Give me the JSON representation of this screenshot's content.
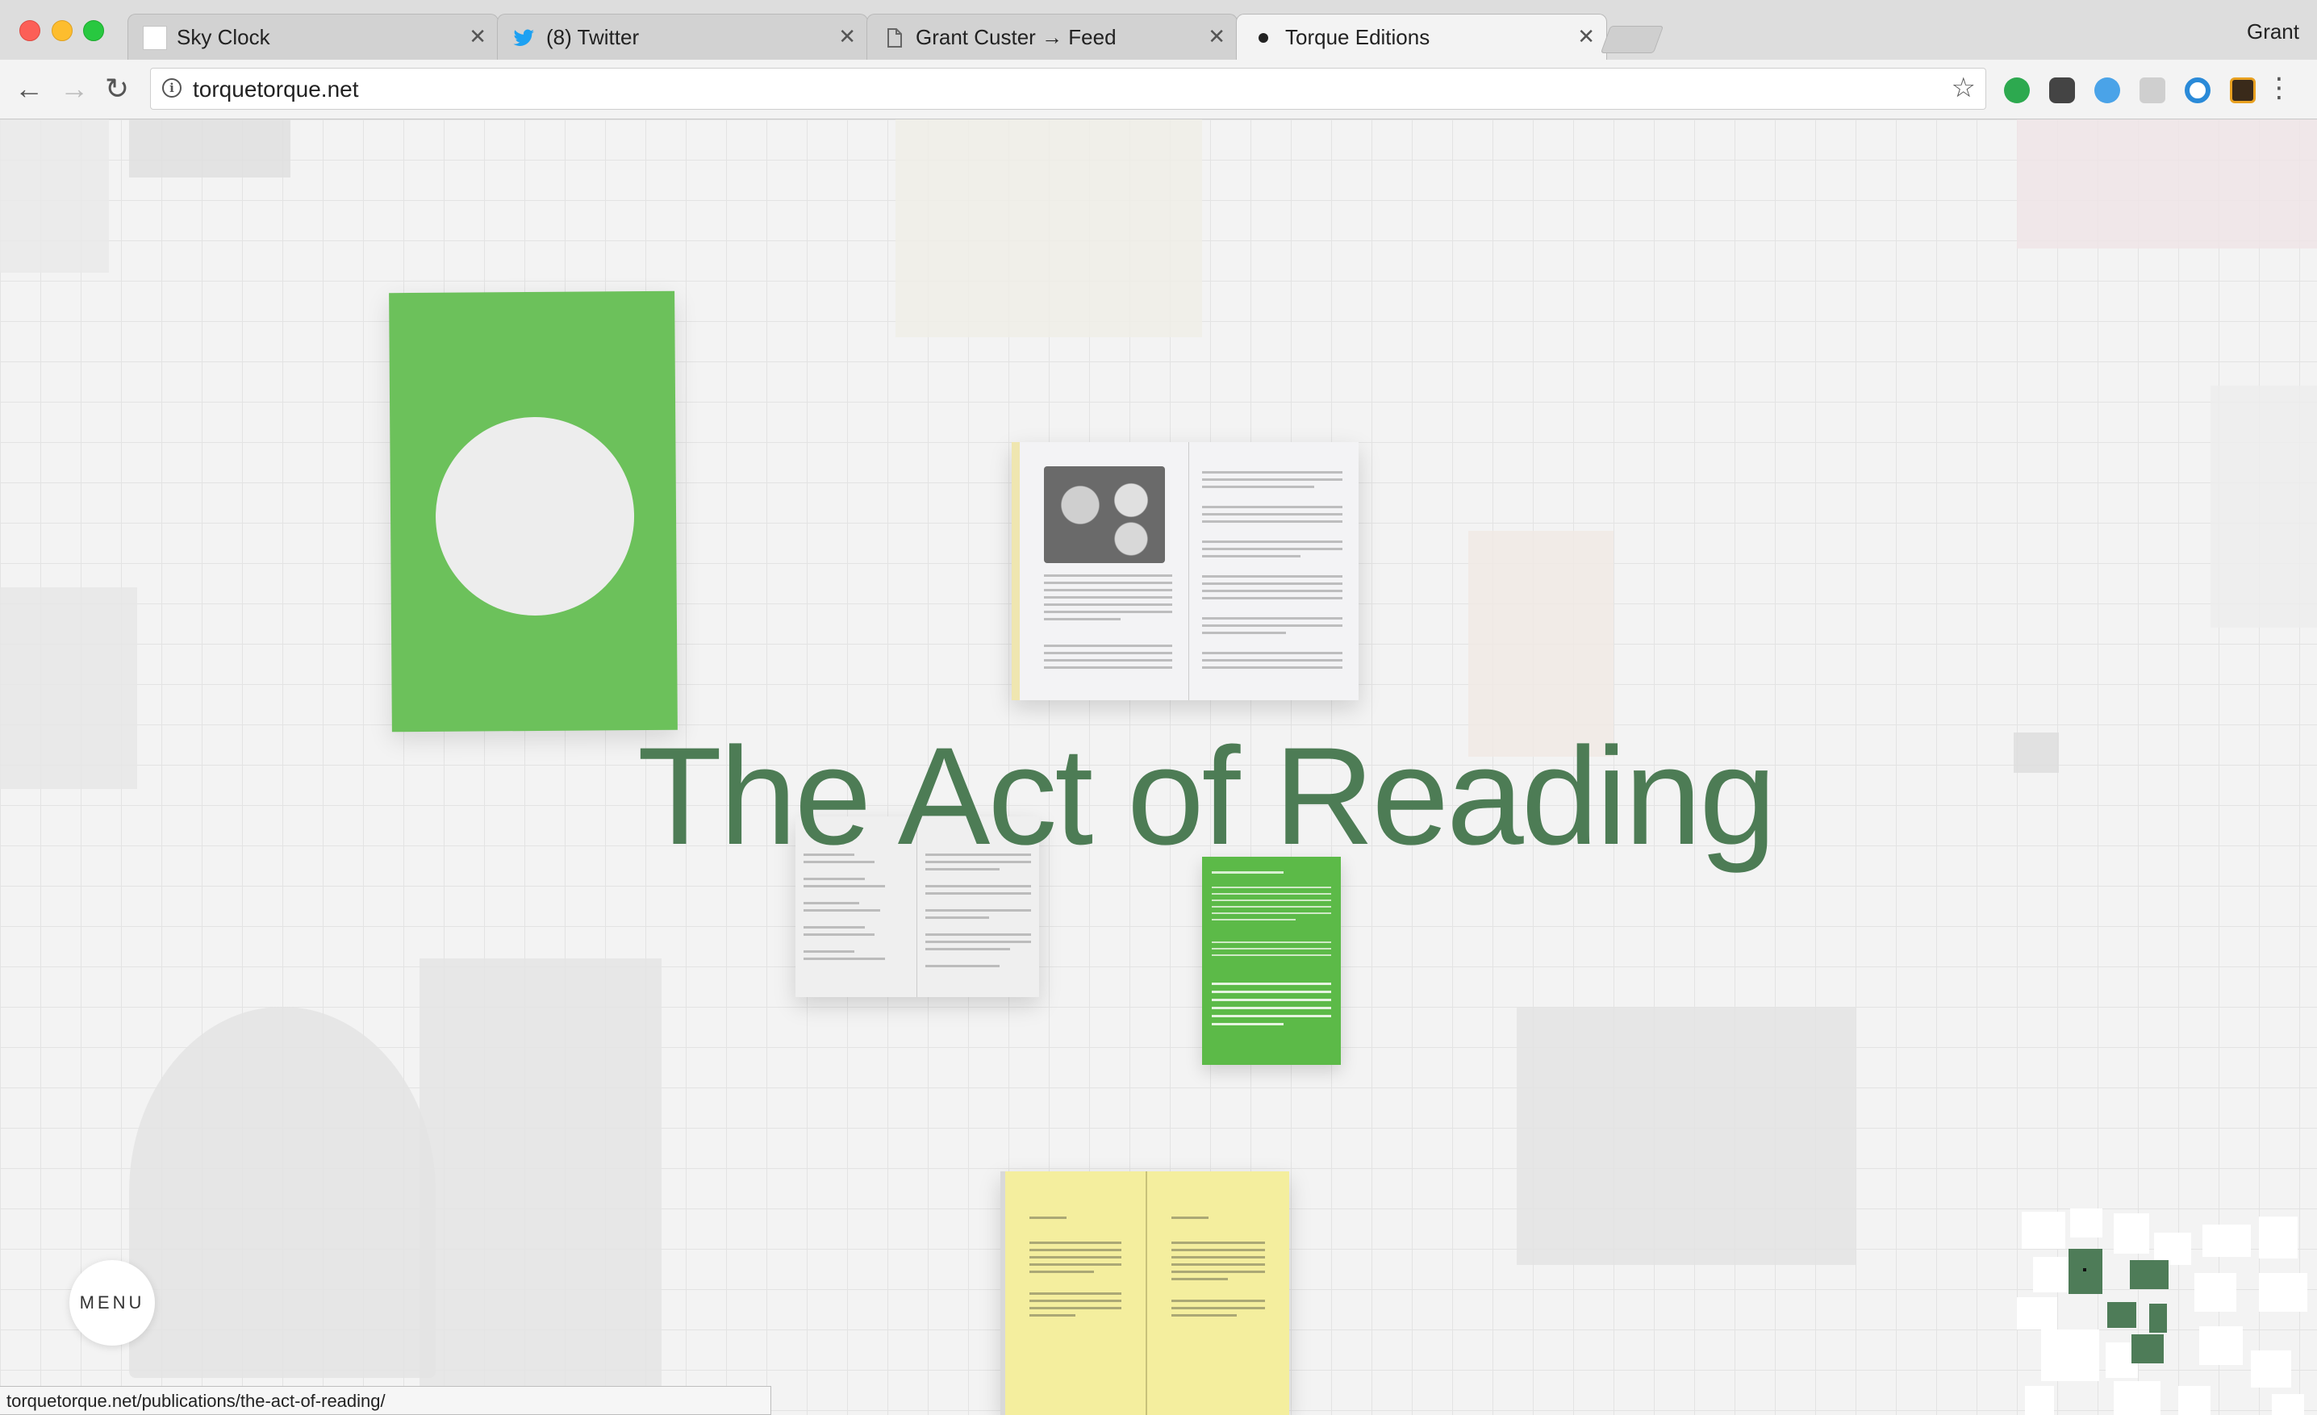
{
  "browser": {
    "tabs": [
      {
        "title": "Sky Clock",
        "icon": "blank-page-icon",
        "active": false
      },
      {
        "title": "(8) Twitter",
        "icon": "twitter-bird-icon",
        "active": false
      },
      {
        "title": "Grant Custer → Feed",
        "icon": "document-icon",
        "active": false
      },
      {
        "title": "Torque Editions",
        "icon": "dot-icon",
        "active": true
      }
    ],
    "profile_name": "Grant",
    "url": "torquetorque.net",
    "status_url": "torquetorque.net/publications/the-act-of-reading/",
    "extensions": [
      "green-extension-icon",
      "camera-extension-icon",
      "blue-v-extension-icon",
      "r-extension-icon",
      "blue-circle-extension-icon",
      "k-extension-icon"
    ]
  },
  "page": {
    "title": "The Act of Reading",
    "menu_label": "MENU",
    "accent_color": "#4d7c55",
    "cover_color": "#6cc15b"
  }
}
